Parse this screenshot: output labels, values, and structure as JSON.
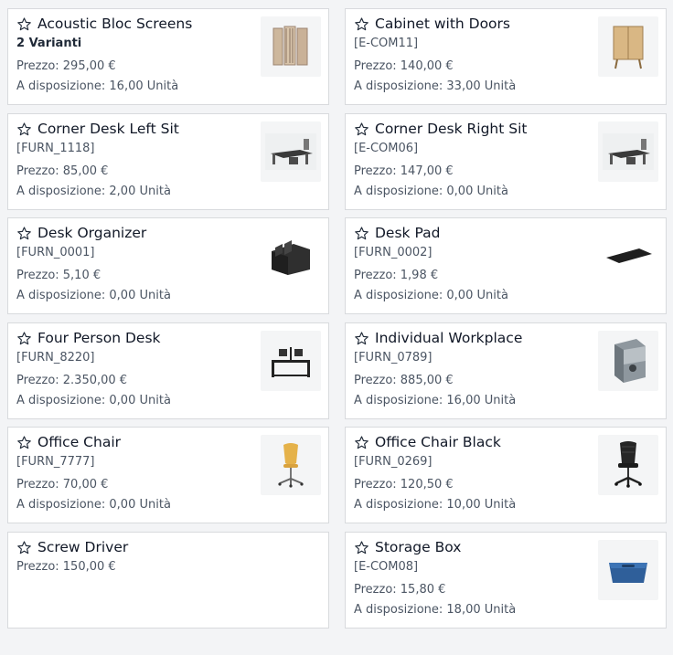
{
  "labels": {
    "price_prefix": "Prezzo: ",
    "stock_prefix": "A disposizione: "
  },
  "products": [
    {
      "name": "Acoustic Bloc Screens",
      "variants": "2 Varianti",
      "price": "295,00 €",
      "stock": "16,00 Unità",
      "icon": "screens-image"
    },
    {
      "name": "Cabinet with Doors",
      "code": "[E-COM11]",
      "price": "140,00 €",
      "stock": "33,00 Unità",
      "icon": "cabinet-image"
    },
    {
      "name": "Corner Desk Left Sit",
      "code": "[FURN_1118]",
      "price": "85,00 €",
      "stock": "2,00 Unità",
      "icon": "corner-desk-image"
    },
    {
      "name": "Corner Desk Right Sit",
      "code": "[E-COM06]",
      "price": "147,00 €",
      "stock": "0,00 Unità",
      "icon": "corner-desk-image"
    },
    {
      "name": "Desk Organizer",
      "code": "[FURN_0001]",
      "price": "5,10 €",
      "stock": "0,00 Unità",
      "icon": "organizer-image"
    },
    {
      "name": "Desk Pad",
      "code": "[FURN_0002]",
      "price": "1,98 €",
      "stock": "0,00 Unità",
      "icon": "desk-pad-image"
    },
    {
      "name": "Four Person Desk",
      "code": "[FURN_8220]",
      "price": "2.350,00 €",
      "stock": "0,00 Unità",
      "icon": "four-desk-image"
    },
    {
      "name": "Individual Workplace",
      "code": "[FURN_0789]",
      "price": "885,00 €",
      "stock": "16,00 Unità",
      "icon": "workplace-image"
    },
    {
      "name": "Office Chair",
      "code": "[FURN_7777]",
      "price": "70,00 €",
      "stock": "0,00 Unità",
      "icon": "office-chair-image"
    },
    {
      "name": "Office Chair Black",
      "code": "[FURN_0269]",
      "price": "120,50 €",
      "stock": "10,00 Unità",
      "icon": "office-chair-black-image"
    },
    {
      "name": "Screw Driver",
      "price": "150,00 €"
    },
    {
      "name": "Storage Box",
      "code": "[E-COM08]",
      "price": "15,80 €",
      "stock": "18,00 Unità",
      "icon": "storage-box-image"
    }
  ]
}
